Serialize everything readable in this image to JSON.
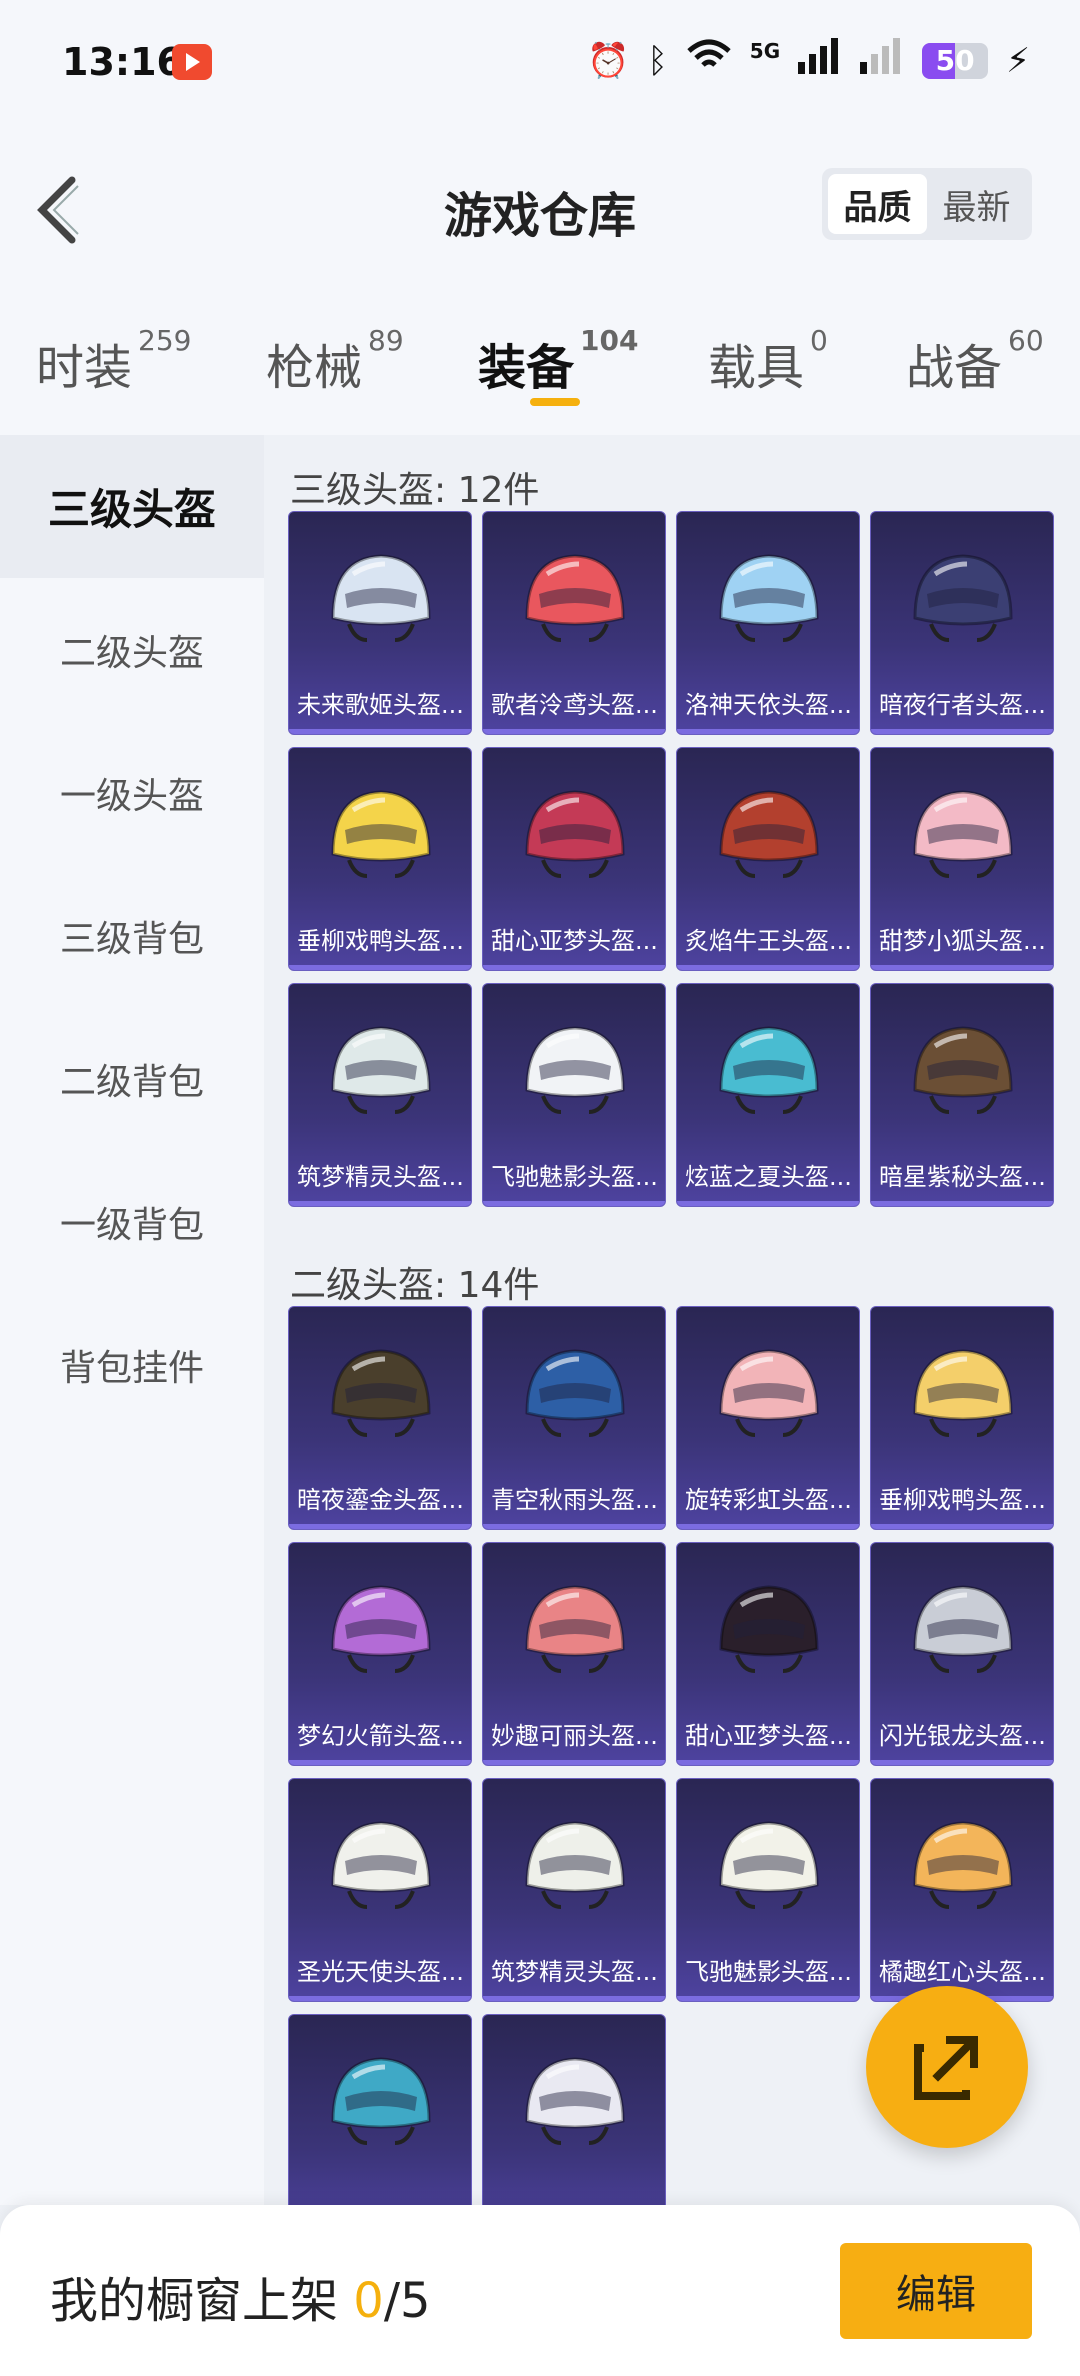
{
  "status_bar": {
    "time": "13:16",
    "battery": "50",
    "network": "5G"
  },
  "header": {
    "title": "游戏仓库",
    "sort_quality": "品质",
    "sort_newest": "最新"
  },
  "tabs": [
    {
      "label": "时装",
      "count": "259"
    },
    {
      "label": "枪械",
      "count": "89"
    },
    {
      "label": "装备",
      "count": "104"
    },
    {
      "label": "载具",
      "count": "0"
    },
    {
      "label": "战备",
      "count": "60"
    }
  ],
  "sidebar": [
    {
      "label": "三级头盔"
    },
    {
      "label": "二级头盔"
    },
    {
      "label": "一级头盔"
    },
    {
      "label": "三级背包"
    },
    {
      "label": "二级背包"
    },
    {
      "label": "一级背包"
    },
    {
      "label": "背包挂件"
    }
  ],
  "sections": [
    {
      "title": "三级头盔: 12件",
      "items": [
        {
          "name": "未来歌姬头盔...",
          "color": "#d9e4f2"
        },
        {
          "name": "歌者泠鸢头盔...",
          "color": "#e9575e"
        },
        {
          "name": "洛神天依头盔...",
          "color": "#9fd2f3"
        },
        {
          "name": "暗夜行者头盔...",
          "color": "#3b3f73"
        },
        {
          "name": "垂柳戏鸭头盔...",
          "color": "#f4d44a"
        },
        {
          "name": "甜心亚梦头盔...",
          "color": "#c43a56"
        },
        {
          "name": "炙焰牛王头盔...",
          "color": "#b3402e"
        },
        {
          "name": "甜梦小狐头盔...",
          "color": "#f3bac6"
        },
        {
          "name": "筑梦精灵头盔...",
          "color": "#dfe9e9"
        },
        {
          "name": "飞驰魅影头盔...",
          "color": "#f1f3f6"
        },
        {
          "name": "炫蓝之夏头盔...",
          "color": "#49bcd1"
        },
        {
          "name": "暗星紫秘头盔...",
          "color": "#6b4f35"
        }
      ]
    },
    {
      "title": "二级头盔: 14件",
      "items": [
        {
          "name": "暗夜鎏金头盔...",
          "color": "#4a3f2c"
        },
        {
          "name": "青空秋雨头盔...",
          "color": "#2d5fa6"
        },
        {
          "name": "旋转彩虹头盔...",
          "color": "#f2b4b8"
        },
        {
          "name": "垂柳戏鸭头盔...",
          "color": "#f4cf6a"
        },
        {
          "name": "梦幻火箭头盔...",
          "color": "#b36bd6"
        },
        {
          "name": "妙趣可丽头盔...",
          "color": "#e98486"
        },
        {
          "name": "甜心亚梦头盔...",
          "color": "#2a1f2b"
        },
        {
          "name": "闪光银龙头盔...",
          "color": "#c9cdd6"
        },
        {
          "name": "圣光天使头盔...",
          "color": "#f0f1ec"
        },
        {
          "name": "筑梦精灵头盔...",
          "color": "#eef0ea"
        },
        {
          "name": "飞驰魅影头盔...",
          "color": "#f2f2e9"
        },
        {
          "name": "橘趣红心头盔...",
          "color": "#f3b55a"
        },
        {
          "name": "",
          "color": "#3fa9c6"
        },
        {
          "name": "",
          "color": "#e9e9f2"
        }
      ]
    }
  ],
  "bottom": {
    "text": "我的橱窗上架 ",
    "count": "0",
    "total": "/5",
    "edit": "编辑"
  }
}
